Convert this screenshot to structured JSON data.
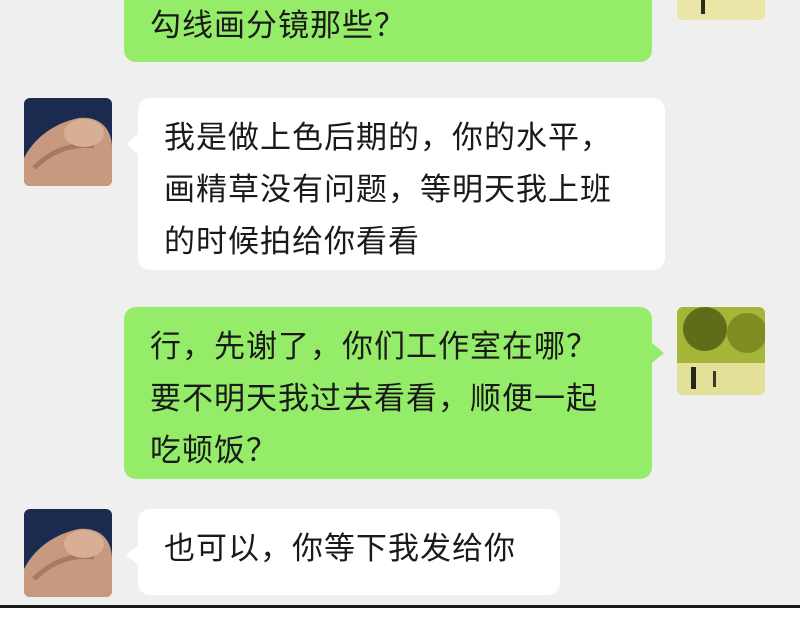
{
  "app": {
    "name": "chat",
    "colors": {
      "background": "#efefef",
      "incoming_bubble": "#ffffff",
      "outgoing_bubble": "#95ec69",
      "text": "#1a1a1a"
    }
  },
  "messages": [
    {
      "side": "out",
      "text": "勾线画分镜那些？"
    },
    {
      "side": "in",
      "text": "我是做上色后期的，你的水平，\n画精草没有问题，等明天我上班\n的时候拍给你看看"
    },
    {
      "side": "out",
      "text": "行，先谢了，你们工作室在哪？\n要不明天我过去看看，顺便一起\n吃顿饭？"
    },
    {
      "side": "in",
      "text": "也可以，你等下我发给你"
    }
  ],
  "avatars": {
    "contact": "muscular-arm-avatar",
    "self": "landscape-figure-avatar"
  }
}
